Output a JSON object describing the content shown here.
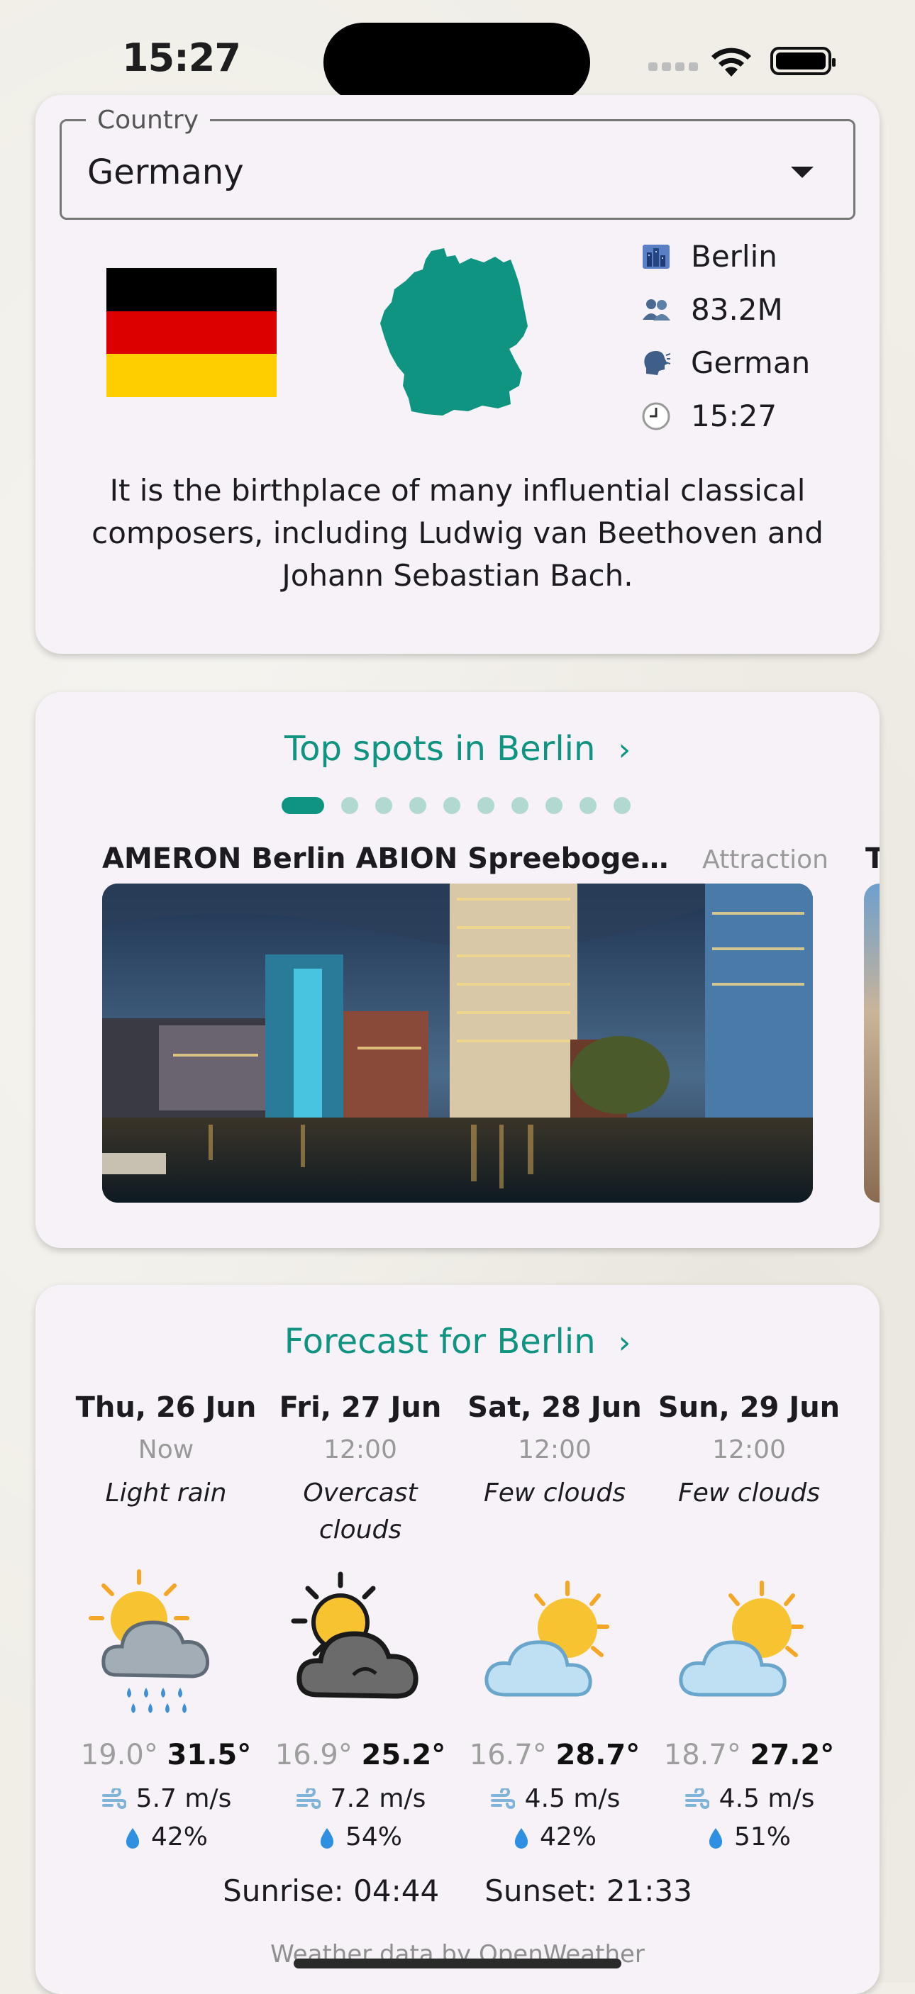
{
  "status_bar": {
    "time": "15:27"
  },
  "country": {
    "select_label": "Country",
    "selected": "Germany",
    "flag_colors": [
      "#000000",
      "#dd0000",
      "#ffce00"
    ],
    "facts": [
      {
        "icon": "cityscape-icon",
        "value": "Berlin"
      },
      {
        "icon": "people-icon",
        "value": "83.2M"
      },
      {
        "icon": "speaking-head-icon",
        "value": "German"
      },
      {
        "icon": "clock-icon",
        "value": "15:27"
      }
    ],
    "description": "It is the birthplace of many influential classical composers, including Ludwig van Beethoven and Johann Sebastian Bach."
  },
  "top_spots": {
    "title": "Top spots in Berlin",
    "page_count": 10,
    "active_index": 0,
    "current": {
      "name": "AMERON Berlin ABION Spreebogen Waterside",
      "category": "Attraction"
    },
    "next_peek_title": "T"
  },
  "forecast": {
    "title": "Forecast for Berlin",
    "days": [
      {
        "date": "Thu, 26 Jun",
        "time": "Now",
        "condition": "Light rain",
        "icon": "sun-cloud-rain-icon",
        "min": "19.0°",
        "max": "31.5°",
        "wind": "5.7 m/s",
        "humidity": "42%"
      },
      {
        "date": "Fri, 27 Jun",
        "time": "12:00",
        "condition": "Overcast clouds",
        "icon": "sun-dark-cloud-icon",
        "min": "16.9°",
        "max": "25.2°",
        "wind": "7.2 m/s",
        "humidity": "54%"
      },
      {
        "date": "Sat, 28 Jun",
        "time": "12:00",
        "condition": "Few clouds",
        "icon": "sun-behind-cloud-icon",
        "min": "16.7°",
        "max": "28.7°",
        "wind": "4.5 m/s",
        "humidity": "42%"
      },
      {
        "date": "Sun, 29 Jun",
        "time": "12:00",
        "condition": "Few clouds",
        "icon": "sun-behind-cloud-icon",
        "min": "18.7°",
        "max": "27.2°",
        "wind": "4.5 m/s",
        "humidity": "51%"
      }
    ],
    "sunrise": "Sunrise: 04:44",
    "sunset": "Sunset: 21:33",
    "credit": "Weather data by OpenWeather"
  }
}
